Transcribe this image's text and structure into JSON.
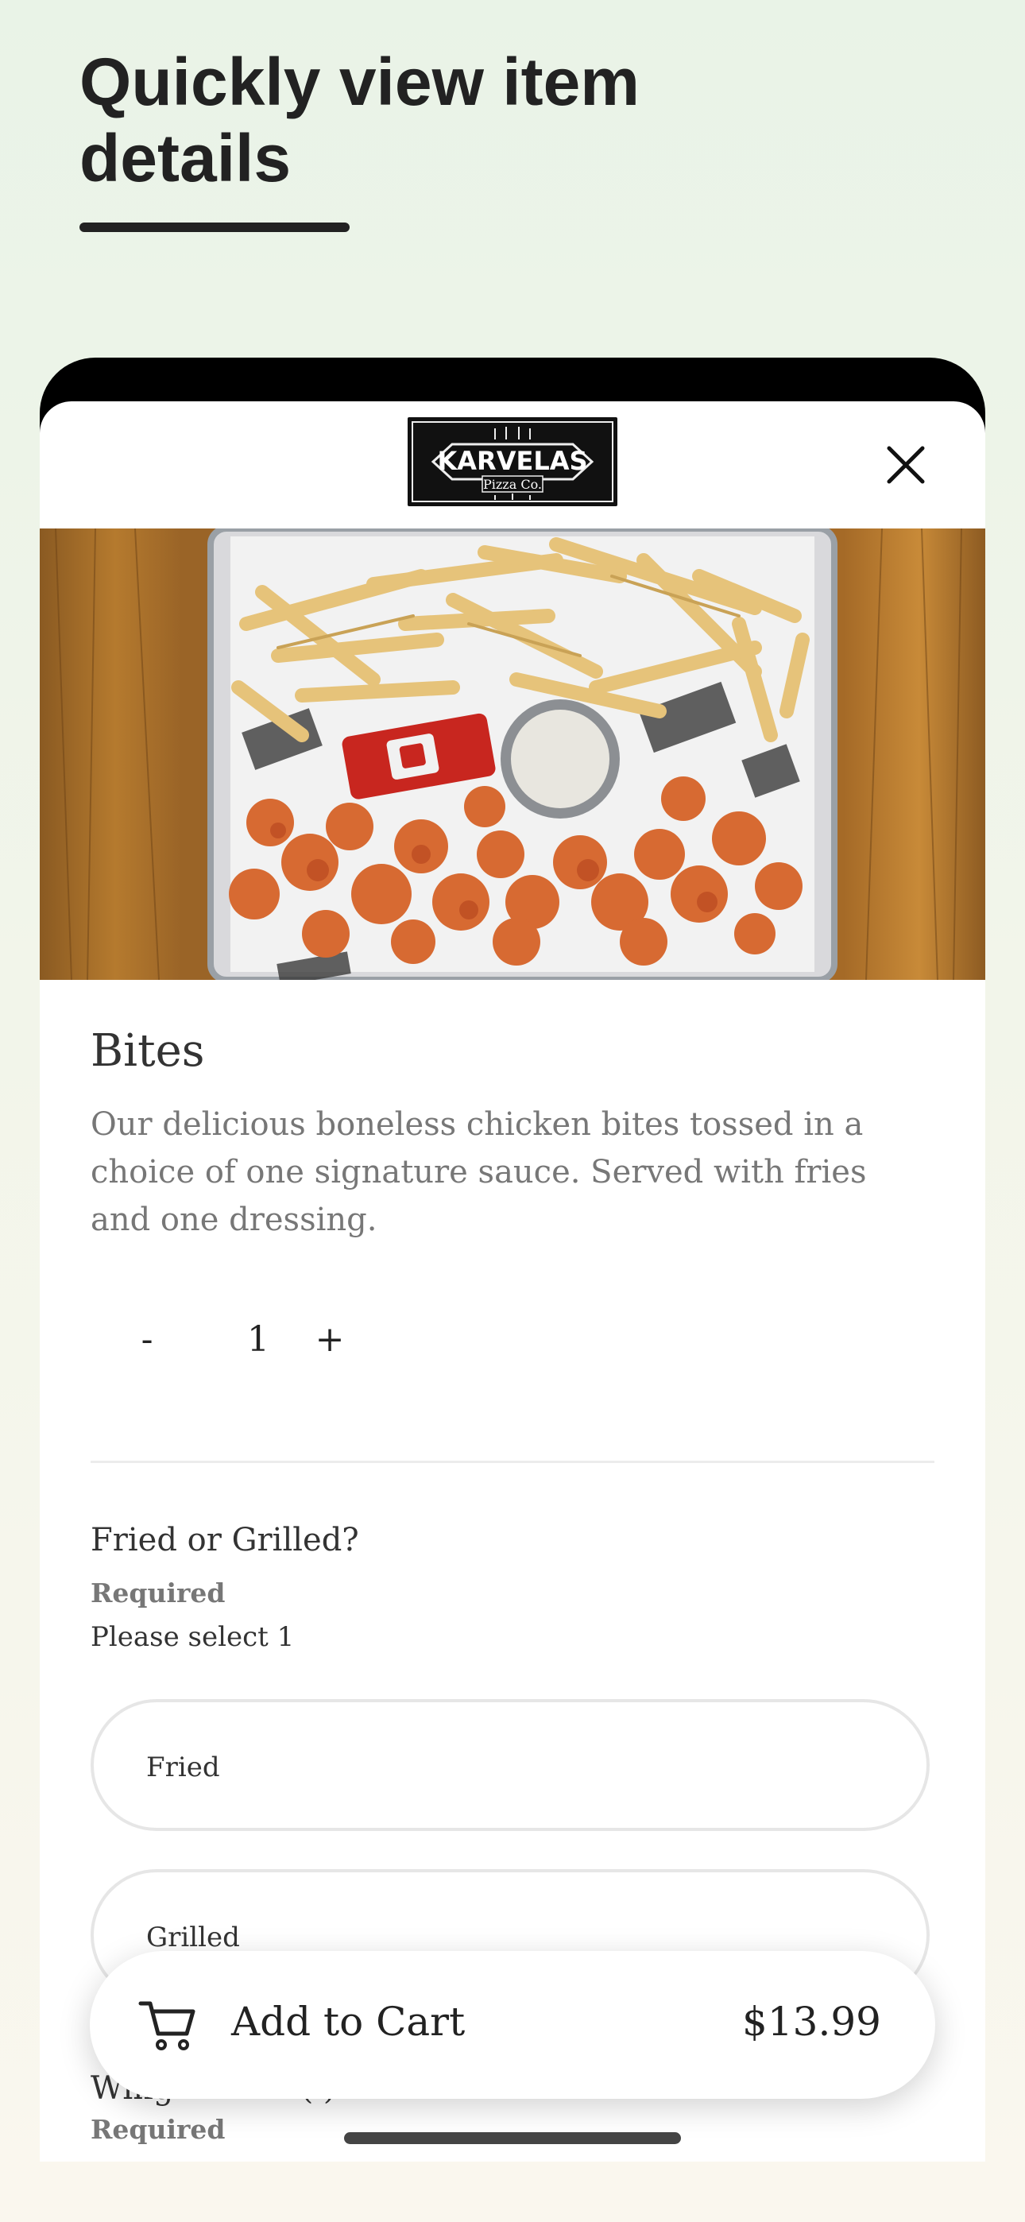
{
  "promo": {
    "title": "Quickly view item details"
  },
  "header": {
    "logo": {
      "brand": "KARVELAS",
      "sub": "Pizza Co."
    },
    "close_icon": "close-icon"
  },
  "item": {
    "title": "Bites",
    "description": "Our delicious boneless chicken bites tossed in a choice of one signature sauce. Served with fries and one dressing.",
    "quantity": {
      "minus": "-",
      "value": "1",
      "plus": "+"
    }
  },
  "question": {
    "title": "Fried or Grilled?",
    "required": "Required",
    "hint": "Please select 1",
    "options": [
      {
        "label": "Fried"
      },
      {
        "label": "Grilled"
      }
    ]
  },
  "next_question": {
    "title_partial": "Wing",
    "suffix_partial": "(  )",
    "required": "Required"
  },
  "cart": {
    "label": "Add to Cart",
    "price": "$13.99",
    "icon": "shopping-cart-icon"
  },
  "colors": {
    "background": "#eef5ea",
    "text": "#222222",
    "muted": "#777777",
    "border": "#e6e6e6"
  }
}
